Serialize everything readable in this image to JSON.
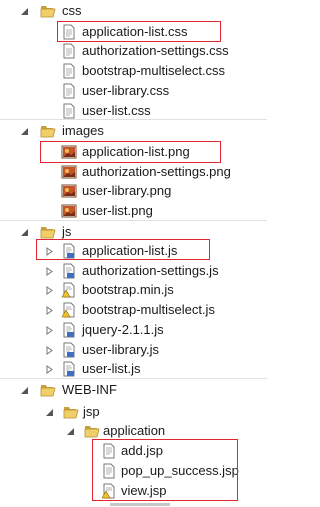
{
  "tree": {
    "css_folder": {
      "label": "css"
    },
    "css_files": [
      {
        "label": "application-list.css"
      },
      {
        "label": "authorization-settings.css"
      },
      {
        "label": "bootstrap-multiselect.css"
      },
      {
        "label": "user-library.css"
      },
      {
        "label": "user-list.css"
      }
    ],
    "images_folder": {
      "label": "images"
    },
    "image_files": [
      {
        "label": "application-list.png"
      },
      {
        "label": "authorization-settings.png"
      },
      {
        "label": "user-library.png"
      },
      {
        "label": "user-list.png"
      }
    ],
    "js_folder": {
      "label": "js"
    },
    "js_files": [
      {
        "label": "application-list.js"
      },
      {
        "label": "authorization-settings.js"
      },
      {
        "label": "bootstrap.min.js"
      },
      {
        "label": "bootstrap-multiselect.js"
      },
      {
        "label": "jquery-2.1.1.js"
      },
      {
        "label": "user-library.js"
      },
      {
        "label": "user-list.js"
      }
    ],
    "webinf_folder": {
      "label": "WEB-INF"
    },
    "jsp_folder": {
      "label": "jsp"
    },
    "application_folder": {
      "label": "application"
    },
    "jsp_files": [
      {
        "label": "add.jsp"
      },
      {
        "label": "pop_up_success.jsp"
      },
      {
        "label": "view.jsp"
      }
    ]
  },
  "colors": {
    "highlight_border": "#e0262e",
    "folder_yellow": "#e8c25a",
    "js_blue": "#3f6fbf"
  }
}
